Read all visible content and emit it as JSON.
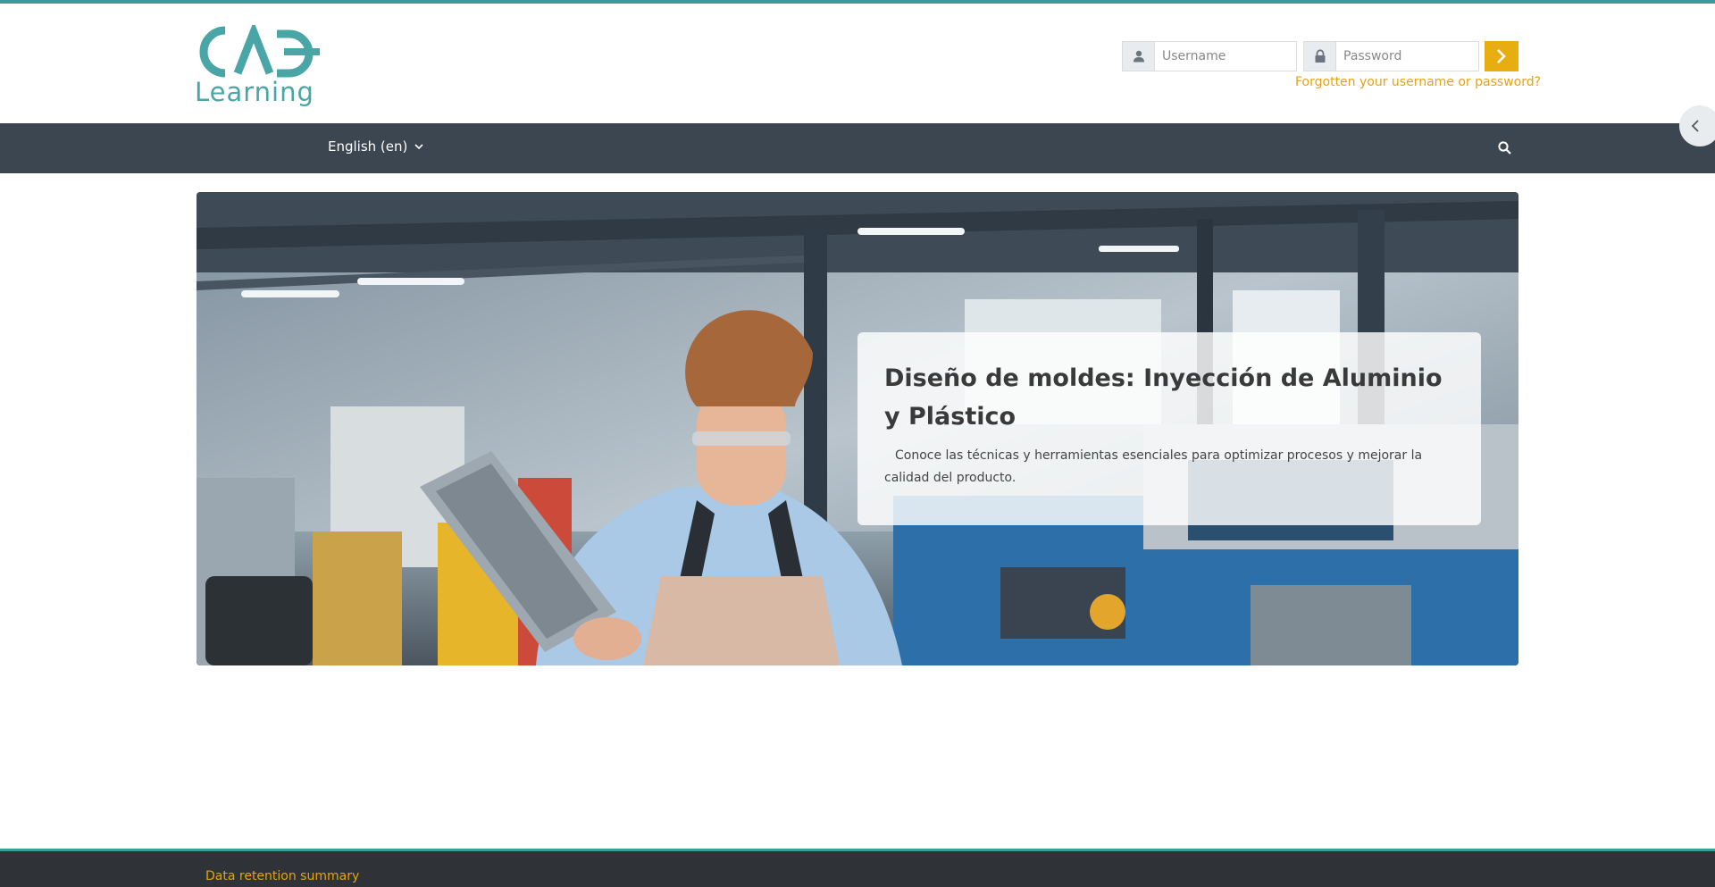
{
  "brand": {
    "logo_letters": "CADE",
    "logo_text": "Learning",
    "accent_color": "#3e9a9a",
    "button_color": "#e8ad11",
    "link_color": "#e8a20e",
    "navbar_color": "#3b4650"
  },
  "login": {
    "username_placeholder": "Username",
    "password_placeholder": "Password",
    "username_icon": "user-icon",
    "password_icon": "lock-icon",
    "submit_icon": "chevron-right-icon",
    "forgot_link": "Forgotten your username or password?"
  },
  "navbar": {
    "language": "English (en)",
    "language_icon": "chevron-down-icon",
    "search_icon": "search-icon"
  },
  "drawer": {
    "toggle_icon": "chevron-left-icon"
  },
  "hero": {
    "title": "Diseño de moldes: Inyección de Aluminio y Plástico",
    "description": "Conoce las técnicas y herramientas esenciales para optimizar procesos y mejorar la calidad del producto."
  },
  "footer": {
    "data_retention_link": "Data retention summary"
  }
}
